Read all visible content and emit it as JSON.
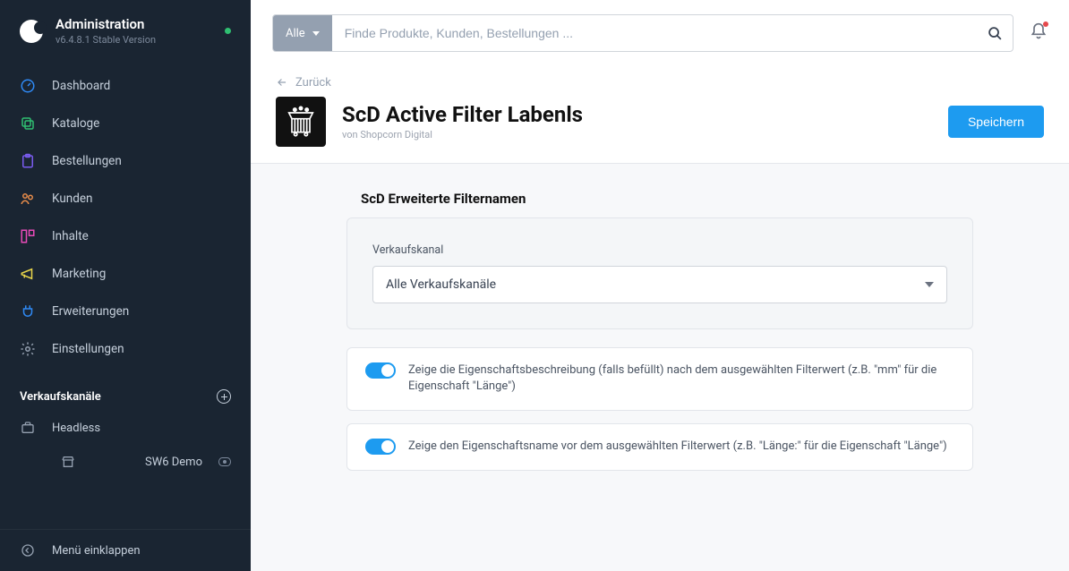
{
  "sidebar": {
    "title": "Administration",
    "version": "v6.4.8.1 Stable Version",
    "nav": [
      {
        "label": "Dashboard",
        "icon": "gauge-icon",
        "color": "#2f8af5"
      },
      {
        "label": "Kataloge",
        "icon": "copy-icon",
        "color": "#2fbf71"
      },
      {
        "label": "Bestellungen",
        "icon": "clipboard-icon",
        "color": "#7a5cf0"
      },
      {
        "label": "Kunden",
        "icon": "users-icon",
        "color": "#e78c4a"
      },
      {
        "label": "Inhalte",
        "icon": "layout-icon",
        "color": "#e84ab8"
      },
      {
        "label": "Marketing",
        "icon": "megaphone-icon",
        "color": "#e8d54a"
      },
      {
        "label": "Erweiterungen",
        "icon": "plug-icon",
        "color": "#2f8af5"
      },
      {
        "label": "Einstellungen",
        "icon": "gear-icon",
        "color": "#94a0b0"
      }
    ],
    "channels_title": "Verkaufskanäle",
    "channels": [
      {
        "label": "Headless"
      },
      {
        "label": "SW6 Demo"
      }
    ],
    "collapse_label": "Menü einklappen"
  },
  "topbar": {
    "filter_label": "Alle",
    "search_placeholder": "Finde Produkte, Kunden, Bestellungen ..."
  },
  "page": {
    "back_label": "Zurück",
    "title": "ScD Active Filter Labenls",
    "subtitle": "von Shopcorn Digital",
    "save_label": "Speichern"
  },
  "config": {
    "section_title": "ScD Erweiterte Filternamen",
    "channel_field_label": "Verkaufskanal",
    "channel_selected": "Alle Verkaufskanäle",
    "toggles": [
      {
        "label": "Zeige die Eigenschaftsbeschreibung (falls befüllt) nach dem ausgewählten Filterwert (z.B. \"mm\" für die Eigenschaft \"Länge\")",
        "on": true
      },
      {
        "label": "Zeige den Eigenschaftsname vor dem ausgewählten Filterwert (z.B. \"Länge:\" für die Eigenschaft \"Länge\")",
        "on": true
      }
    ]
  }
}
